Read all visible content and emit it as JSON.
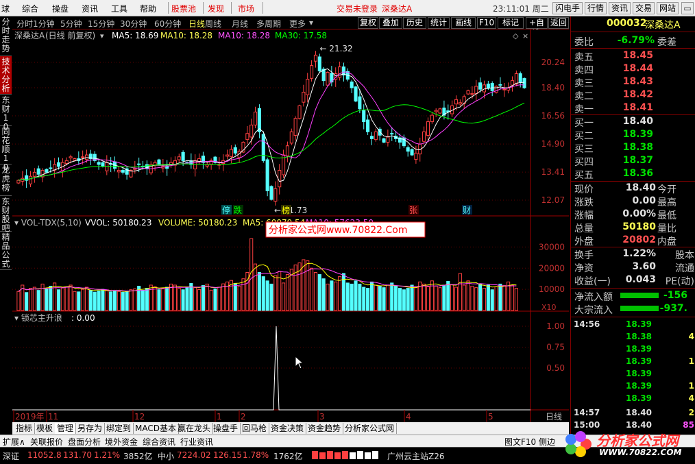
{
  "menu": {
    "items": [
      "球",
      "综合",
      "操盘",
      "资讯",
      "工具",
      "帮助"
    ],
    "red_items": [
      "股票池",
      "发现",
      "市场"
    ],
    "login_status": "交易未登录",
    "stock_title": "深桑达A",
    "clock": "23:11:01 周二",
    "buttons": [
      "闪电手",
      "行情",
      "资讯",
      "交易",
      "网站"
    ]
  },
  "periods": [
    "分时",
    "1分钟",
    "5分钟",
    "15分钟",
    "30分钟",
    "60分钟",
    "日线",
    "周线",
    "月线",
    "多周期",
    "更多"
  ],
  "selected_period": "日线",
  "toolbar": [
    "复权",
    "叠加",
    "历史",
    "统计",
    "画线",
    "F10",
    "标记",
    "+自选",
    "返回"
  ],
  "left_tabs": [
    {
      "label": "分时走势",
      "selected": false
    },
    {
      "label": "技术分析",
      "selected": true
    },
    {
      "label": "东财10",
      "selected": false
    },
    {
      "label": "同花顺10",
      "selected": false
    },
    {
      "label": "龙虎榜",
      "selected": false
    },
    {
      "label": "东财股吧",
      "selected": false
    },
    {
      "label": "精品公式",
      "selected": false
    }
  ],
  "main_legend": {
    "name": "深桑达A",
    "mode": "(日线 前复权)",
    "ma5": "MA5: 18.69",
    "ma10a": "MA10: 18.28",
    "ma10b": "MA10: 18.28",
    "ma30": "MA30: 17.58"
  },
  "vol_legend": {
    "name": "VOL-TDX(5,10)",
    "vvol": "VVOL: 50180.23",
    "volume": "VOLUME: 50180.23",
    "ma5": "MA5: 60079.54",
    "ma10": "MA10: 57623.50"
  },
  "ind_legend": {
    "name": "锁芯主升浪",
    "value": ": 0.00"
  },
  "watermark": "分析家公式网www.70822.Com",
  "price_annotations": {
    "high": "21.32",
    "low": "11.73"
  },
  "event_labels": [
    {
      "text": "停",
      "color": "#54ffff",
      "bg": "#005050"
    },
    {
      "text": "跌",
      "color": "#00ff00",
      "bg": "#003000"
    },
    {
      "text": "榜",
      "color": "#ffff00",
      "bg": "#303000"
    },
    {
      "text": "张",
      "color": "#ff5050",
      "bg": "#400000"
    },
    {
      "text": "财",
      "color": "#54ffff",
      "bg": "#002040"
    }
  ],
  "vol_multiplier": "X10",
  "chart_data": {
    "type": "candlestick",
    "price_axis": [
      "20.24",
      "18.40",
      "16.56",
      "14.90",
      "13.41",
      "12.07"
    ],
    "vol_axis": [
      "30000",
      "20000",
      "10000"
    ],
    "ind_axis": [
      "1.00",
      "0.75",
      "0.50"
    ],
    "x_labels": [
      "2019年",
      "11",
      "12",
      "1",
      "2",
      "3",
      "4",
      "5"
    ],
    "x_axis_name": "日线",
    "colors": {
      "up": "#ff4040",
      "down": "#54ffff",
      "ma5": "#ffffff",
      "ma10": "#ffff00",
      "ma10b": "#ff40ff",
      "ma30": "#00ff00"
    },
    "closes": [
      13.0,
      13.1,
      13.0,
      13.2,
      13.4,
      13.3,
      13.5,
      13.4,
      13.6,
      13.8,
      13.7,
      13.9,
      14.0,
      14.2,
      14.1,
      14.0,
      14.2,
      14.3,
      14.1,
      14.0,
      13.8,
      13.7,
      13.9,
      13.8,
      13.6,
      13.5,
      13.4,
      13.3,
      13.5,
      13.6,
      13.8,
      13.7,
      13.6,
      13.8,
      13.9,
      13.8,
      13.7,
      13.6,
      13.9,
      14.0,
      14.2,
      14.0,
      13.9,
      13.8,
      14.0,
      14.1,
      13.9,
      13.8,
      14.0,
      13.9,
      13.8,
      14.0,
      14.3,
      14.6,
      14.4,
      14.5,
      15.0,
      15.5,
      16.0,
      16.8,
      15.6,
      14.0,
      12.5,
      12.1,
      12.6,
      13.5,
      14.3,
      14.8,
      15.6,
      16.4,
      17.2,
      18.1,
      19.0,
      20.0,
      20.8,
      19.6,
      18.9,
      19.5,
      18.8,
      19.4,
      19.9,
      19.3,
      19.0,
      18.4,
      17.5,
      17.0,
      16.2,
      15.6,
      15.2,
      15.6,
      15.4,
      15.0,
      15.3,
      15.5,
      15.2,
      15.0,
      14.8,
      14.5,
      14.3,
      14.4,
      14.9,
      15.6,
      16.2,
      16.6,
      16.9,
      17.0,
      16.6,
      16.8,
      17.2,
      17.6,
      17.4,
      17.8,
      18.2,
      18.0,
      18.5,
      18.3,
      18.6,
      18.4,
      18.2,
      18.5,
      18.6,
      18.3,
      18.4,
      18.9,
      19.4,
      18.8,
      18.4
    ],
    "volumes": [
      9000,
      12000,
      8500,
      10500,
      11000,
      9500,
      12500,
      10000,
      11500,
      13000,
      9800,
      10800,
      11200,
      12000,
      9000,
      8800,
      10000,
      11000,
      9500,
      8700,
      9200,
      10000,
      9600,
      8800,
      9400,
      9000,
      8600,
      9200,
      9800,
      10200,
      11500,
      9500,
      10500,
      12000,
      11200,
      9800,
      10200,
      11000,
      12500,
      12000,
      10500,
      9800,
      11000,
      12800,
      10800,
      9900,
      11800,
      12500,
      9600,
      10200,
      11000,
      12600,
      13500,
      14200,
      12800,
      11500,
      15000,
      18000,
      34000,
      22000,
      18000,
      16000,
      14000,
      12500,
      16500,
      18500,
      13000,
      17000,
      19500,
      21500,
      22500,
      24000,
      23500,
      20000,
      18000,
      17000,
      15000,
      12500,
      14000,
      13500,
      16000,
      17500,
      13000,
      12500,
      14000,
      12500,
      11000,
      10500,
      13500,
      12000,
      11500,
      10800,
      12000,
      13000,
      11500,
      10500,
      9800,
      10500,
      12000,
      11000,
      13500,
      12500,
      11200,
      14000,
      11500,
      10800,
      12000,
      13800,
      12200,
      11000,
      17500,
      12000,
      14000,
      11500,
      10800,
      12500,
      10500,
      12000,
      9800,
      11200,
      12500,
      11800,
      13500,
      12000,
      10500
    ]
  },
  "right": {
    "code": "000032",
    "name": "深桑达A",
    "weibi_label": "委比",
    "weibi_val": "-6.79%",
    "weicha_label": "委差",
    "sells": [
      {
        "label": "卖五",
        "price": "18.45"
      },
      {
        "label": "卖四",
        "price": "18.44"
      },
      {
        "label": "卖三",
        "price": "18.43"
      },
      {
        "label": "卖二",
        "price": "18.42"
      },
      {
        "label": "卖一",
        "price": "18.41"
      }
    ],
    "buys": [
      {
        "label": "买一",
        "price": "18.40"
      },
      {
        "label": "买二",
        "price": "18.39"
      },
      {
        "label": "买三",
        "price": "18.38"
      },
      {
        "label": "买四",
        "price": "18.37"
      },
      {
        "label": "买五",
        "price": "18.36"
      }
    ],
    "stats": [
      {
        "l1": "现价",
        "v": "18.40",
        "c": "white",
        "l2": "今开"
      },
      {
        "l1": "涨跌",
        "v": "0.00",
        "c": "white",
        "l2": "最高"
      },
      {
        "l1": "涨幅",
        "v": "0.00%",
        "c": "white",
        "l2": "最低"
      },
      {
        "l1": "总量",
        "v": "50180",
        "c": "yellow",
        "l2": "量比"
      },
      {
        "l1": "外盘",
        "v": "20802",
        "c": "red",
        "l2": "内盘"
      }
    ],
    "stats2": [
      {
        "l1": "换手",
        "v": "1.22%",
        "c": "white",
        "l2": "股本"
      },
      {
        "l1": "净资",
        "v": "3.60",
        "c": "white",
        "l2": "流通"
      },
      {
        "l1": "收益(一)",
        "v": "0.043",
        "c": "white",
        "l2": "PE(动)"
      }
    ],
    "flow": [
      {
        "label": "净流入额",
        "val": "-156"
      },
      {
        "label": "大宗流入",
        "val": "-937."
      }
    ],
    "ticks": [
      {
        "time": "14:56",
        "price": "18.39",
        "vol": ""
      },
      {
        "time": "",
        "price": "18.38",
        "vol": "4"
      },
      {
        "time": "",
        "price": "18.39",
        "vol": ""
      },
      {
        "time": "",
        "price": "18.39",
        "vol": "1"
      },
      {
        "time": "",
        "price": "18.39",
        "vol": ""
      },
      {
        "time": "",
        "price": "18.39",
        "vol": "1"
      },
      {
        "time": "",
        "price": "18.39",
        "vol": "4"
      },
      {
        "time": "14:57",
        "price": "18.40",
        "vol": "2"
      },
      {
        "time": "15:00",
        "price": "18.40",
        "vol": "85"
      }
    ]
  },
  "bottom_tabs": [
    "指标",
    "模板",
    "管理",
    "另存为",
    "绑定到",
    "MACD基本",
    "赢在龙头",
    "操盘手",
    "回马枪",
    "资金决策",
    "资金趋势",
    "分析家公式网"
  ],
  "bottom_tab_selected": "管理",
  "bar2": [
    "扩展∧",
    "关联报价",
    "盘面分析",
    "境外资金",
    "综合资讯",
    "行业资讯"
  ],
  "bar2_right": [
    "图文F10",
    "侧边"
  ],
  "status": {
    "sz_name": "深证",
    "sz_val": "11052.8",
    "sz_chg": "131.70",
    "sz_pct": "1.21%",
    "sz_amt": "3852亿",
    "zx_name": "中小",
    "zx_val": "7224.02",
    "zx_chg": "126.15",
    "zx_pct": "1.78%",
    "zx_amt": "1762亿",
    "server": "广州云主站Z26"
  },
  "logo": {
    "line1": "分析家公式网",
    "line2": "WWW.70822.COM"
  }
}
